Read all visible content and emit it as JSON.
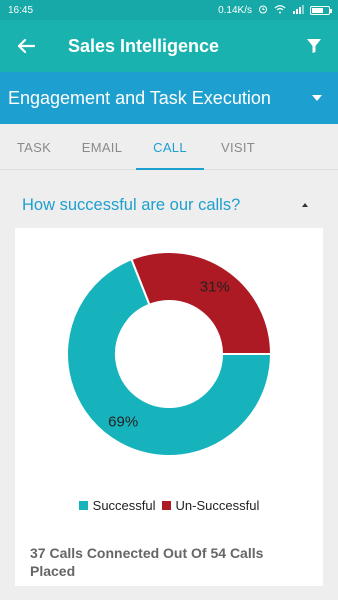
{
  "status_bar": {
    "time": "16:45",
    "speed": "0.14K/s"
  },
  "app_bar": {
    "title": "Sales Intelligence"
  },
  "section": {
    "title": "Engagement and Task Execution"
  },
  "tabs": [
    {
      "label": "TASK",
      "active": false
    },
    {
      "label": "EMAIL",
      "active": false
    },
    {
      "label": "CALL",
      "active": true
    },
    {
      "label": "VISIT",
      "active": false
    }
  ],
  "question": "How successful are our calls?",
  "chart_data": {
    "type": "pie",
    "style": "donut",
    "title": "",
    "categories": [
      "Successful",
      "Un-Successful"
    ],
    "values": [
      69,
      31
    ],
    "labels": [
      "69%",
      "31%"
    ],
    "colors": [
      "#16b3bd",
      "#ad1a23"
    ],
    "legend": "bottom"
  },
  "summary": "37 Calls Connected Out Of 54 Calls Placed",
  "colors": {
    "primary": "#1ab2ae",
    "accent": "#1d9fd0",
    "background": "#eeeeee"
  }
}
